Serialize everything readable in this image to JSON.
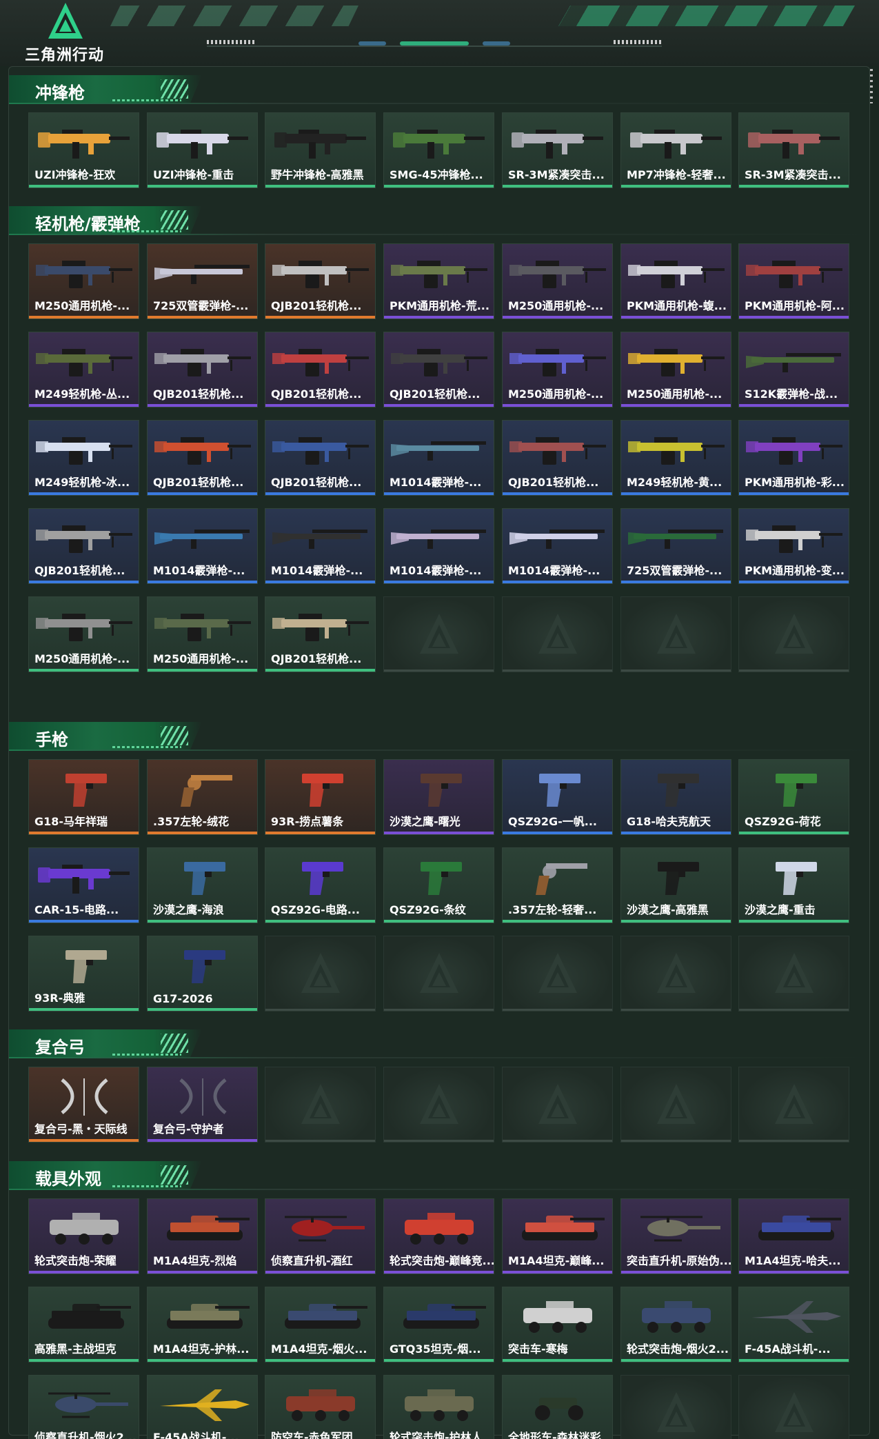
{
  "header": {
    "logo_text": "三角洲行动"
  },
  "sections": [
    {
      "title": "冲锋枪",
      "items": [
        {
          "name": "UZI冲锋枪-狂欢",
          "rarity": "green",
          "art": "smg",
          "color": "#e8a23a"
        },
        {
          "name": "UZI冲锋枪-重击",
          "rarity": "green",
          "art": "smg",
          "color": "#d8d8e8"
        },
        {
          "name": "野牛冲锋枪-高雅黑",
          "rarity": "green",
          "art": "smg",
          "color": "#222222"
        },
        {
          "name": "SMG-45冲锋枪...",
          "rarity": "green",
          "art": "smg",
          "color": "#4a7a3a"
        },
        {
          "name": "SR-3M紧凑突击...",
          "rarity": "green",
          "art": "smg",
          "color": "#b0b0b8"
        },
        {
          "name": "MP7冲锋枪-轻奢...",
          "rarity": "green",
          "art": "smg",
          "color": "#c8c8cc"
        },
        {
          "name": "SR-3M紧凑突击...",
          "rarity": "green",
          "art": "smg",
          "color": "#a86060"
        }
      ]
    },
    {
      "title": "轻机枪/霰弹枪",
      "items": [
        {
          "name": "M250通用机枪-...",
          "rarity": "gold",
          "art": "lmg",
          "color": "#3a4a6a"
        },
        {
          "name": "725双管霰弹枪-...",
          "rarity": "gold",
          "art": "shotgun",
          "color": "#c8c8d8"
        },
        {
          "name": "QJB201轻机枪...",
          "rarity": "gold",
          "art": "lmg",
          "color": "#c0c0c0"
        },
        {
          "name": "PKM通用机枪-荒...",
          "rarity": "purple",
          "art": "lmg",
          "color": "#6a7a4a"
        },
        {
          "name": "M250通用机枪-...",
          "rarity": "purple",
          "art": "lmg",
          "color": "#5a5a60"
        },
        {
          "name": "PKM通用机枪-蝮...",
          "rarity": "purple",
          "art": "lmg",
          "color": "#d0d0d8"
        },
        {
          "name": "PKM通用机枪-阿...",
          "rarity": "purple",
          "art": "lmg",
          "color": "#a04040"
        },
        {
          "name": "M249轻机枪-丛...",
          "rarity": "purple",
          "art": "lmg",
          "color": "#5a6a3a"
        },
        {
          "name": "QJB201轻机枪...",
          "rarity": "purple",
          "art": "lmg",
          "color": "#a0a0a8"
        },
        {
          "name": "QJB201轻机枪...",
          "rarity": "purple",
          "art": "lmg",
          "color": "#c04040"
        },
        {
          "name": "QJB201轻机枪...",
          "rarity": "purple",
          "art": "lmg",
          "color": "#404040"
        },
        {
          "name": "M250通用机枪-...",
          "rarity": "purple",
          "art": "lmg",
          "color": "#6060d0"
        },
        {
          "name": "M250通用机枪-...",
          "rarity": "purple",
          "art": "lmg",
          "color": "#e0b030"
        },
        {
          "name": "S12K霰弹枪-战...",
          "rarity": "purple",
          "art": "shotgun",
          "color": "#4a6a3a"
        },
        {
          "name": "M249轻机枪-冰...",
          "rarity": "blue",
          "art": "lmg",
          "color": "#d8e0f0"
        },
        {
          "name": "QJB201轻机枪...",
          "rarity": "blue",
          "art": "lmg",
          "color": "#d05030"
        },
        {
          "name": "QJB201轻机枪...",
          "rarity": "blue",
          "art": "lmg",
          "color": "#3a5aa0"
        },
        {
          "name": "M1014霰弹枪-...",
          "rarity": "blue",
          "art": "shotgun",
          "color": "#5a8aa0"
        },
        {
          "name": "QJB201轻机枪...",
          "rarity": "blue",
          "art": "lmg",
          "color": "#a05050"
        },
        {
          "name": "M249轻机枪-黄...",
          "rarity": "blue",
          "art": "lmg",
          "color": "#c8c030"
        },
        {
          "name": "PKM通用机枪-彩...",
          "rarity": "blue",
          "art": "lmg",
          "color": "#8040c0"
        },
        {
          "name": "QJB201轻机枪...",
          "rarity": "blue",
          "art": "lmg",
          "color": "#a0a0a0"
        },
        {
          "name": "M1014霰弹枪-...",
          "rarity": "blue",
          "art": "shotgun",
          "color": "#3a7ab0"
        },
        {
          "name": "M1014霰弹枪-...",
          "rarity": "blue",
          "art": "shotgun",
          "color": "#303030"
        },
        {
          "name": "M1014霰弹枪-...",
          "rarity": "blue",
          "art": "shotgun",
          "color": "#c0b0d0"
        },
        {
          "name": "M1014霰弹枪-...",
          "rarity": "blue",
          "art": "shotgun",
          "color": "#d0d0e8"
        },
        {
          "name": "725双管霰弹枪-...",
          "rarity": "blue",
          "art": "shotgun",
          "color": "#2a6a3a"
        },
        {
          "name": "PKM通用机枪-变...",
          "rarity": "blue",
          "art": "lmg",
          "color": "#d0d0d0"
        },
        {
          "name": "M250通用机枪-...",
          "rarity": "green",
          "art": "lmg",
          "color": "#909090"
        },
        {
          "name": "M250通用机枪-...",
          "rarity": "green",
          "art": "lmg",
          "color": "#5a6a4a"
        },
        {
          "name": "QJB201轻机枪...",
          "rarity": "green",
          "art": "lmg",
          "color": "#c0b090"
        },
        {
          "empty": true
        },
        {
          "empty": true
        },
        {
          "empty": true
        },
        {
          "empty": true
        }
      ]
    },
    {
      "title": "手枪",
      "items": [
        {
          "name": "G18-马年祥瑞",
          "rarity": "gold",
          "art": "pistol",
          "color": "#c04030"
        },
        {
          "name": ".357左轮-绒花",
          "rarity": "gold",
          "art": "revolver",
          "color": "#c08040"
        },
        {
          "name": "93R-捞点薯条",
          "rarity": "gold",
          "art": "pistol",
          "color": "#d04030"
        },
        {
          "name": "沙漠之鹰-曙光",
          "rarity": "purple",
          "art": "pistol",
          "color": "#5a3a30"
        },
        {
          "name": "QSZ92G-一帆...",
          "rarity": "blue",
          "art": "pistol",
          "color": "#6a8ad0"
        },
        {
          "name": "G18-哈夫克航天",
          "rarity": "blue",
          "art": "pistol",
          "color": "#303030"
        },
        {
          "name": "QSZ92G-荷花",
          "rarity": "green",
          "art": "pistol",
          "color": "#3a8a3a"
        },
        {
          "name": "CAR-15-电路...",
          "rarity": "blue",
          "art": "smg",
          "color": "#6a3ad0"
        },
        {
          "name": "沙漠之鹰-海浪",
          "rarity": "green",
          "art": "pistol",
          "color": "#3a6aa0"
        },
        {
          "name": "QSZ92G-电路...",
          "rarity": "green",
          "art": "pistol",
          "color": "#5a3ad0"
        },
        {
          "name": "QSZ92G-条纹",
          "rarity": "green",
          "art": "pistol",
          "color": "#2a7a3a"
        },
        {
          "name": ".357左轮-轻奢...",
          "rarity": "green",
          "art": "revolver",
          "color": "#a0a0a8"
        },
        {
          "name": "沙漠之鹰-高雅黑",
          "rarity": "green",
          "art": "pistol",
          "color": "#1a1a1a"
        },
        {
          "name": "沙漠之鹰-重击",
          "rarity": "green",
          "art": "pistol",
          "color": "#d0d8e8"
        },
        {
          "name": "93R-典雅",
          "rarity": "green",
          "art": "pistol",
          "color": "#b0a890"
        },
        {
          "name": "G17-2026",
          "rarity": "green",
          "art": "pistol",
          "color": "#2a3a80"
        },
        {
          "empty": true
        },
        {
          "empty": true
        },
        {
          "empty": true
        },
        {
          "empty": true
        },
        {
          "empty": true
        }
      ]
    },
    {
      "title": "复合弓",
      "items": [
        {
          "name": "复合弓-黑・天际线",
          "rarity": "gold",
          "art": "bow",
          "color": "#d0d0d0"
        },
        {
          "name": "复合弓-守护者",
          "rarity": "purple",
          "art": "bow",
          "color": "#606070"
        },
        {
          "empty": true
        },
        {
          "empty": true
        },
        {
          "empty": true
        },
        {
          "empty": true
        },
        {
          "empty": true
        }
      ]
    },
    {
      "title": "载具外观",
      "items": [
        {
          "name": "轮式突击炮-荣耀",
          "rarity": "purple",
          "art": "vehicle",
          "color": "#b0b0b0"
        },
        {
          "name": "M1A4坦克-烈焰",
          "rarity": "purple",
          "art": "tank",
          "color": "#c05030"
        },
        {
          "name": "侦察直升机-酒红",
          "rarity": "purple",
          "art": "heli",
          "color": "#a02020"
        },
        {
          "name": "轮式突击炮-巅峰竞...",
          "rarity": "purple",
          "art": "vehicle",
          "color": "#d04030"
        },
        {
          "name": "M1A4坦克-巅峰...",
          "rarity": "purple",
          "art": "tank",
          "color": "#d05040"
        },
        {
          "name": "突击直升机-原始伪...",
          "rarity": "purple",
          "art": "heli",
          "color": "#707060"
        },
        {
          "name": "M1A4坦克-哈夫...",
          "rarity": "purple",
          "art": "tank",
          "color": "#3a4aa0"
        },
        {
          "name": "高雅黑-主战坦克",
          "rarity": "green",
          "art": "tank",
          "color": "#1a1a1a"
        },
        {
          "name": "M1A4坦克-护林...",
          "rarity": "green",
          "art": "tank",
          "color": "#7a7a5a"
        },
        {
          "name": "M1A4坦克-烟火...",
          "rarity": "green",
          "art": "tank",
          "color": "#3a4a70"
        },
        {
          "name": "GTQ35坦克-烟...",
          "rarity": "green",
          "art": "tank",
          "color": "#2a3a6a"
        },
        {
          "name": "突击车-寒梅",
          "rarity": "green",
          "art": "vehicle",
          "color": "#d0d0d0"
        },
        {
          "name": "轮式突击炮-烟火2...",
          "rarity": "green",
          "art": "vehicle",
          "color": "#3a4a70"
        },
        {
          "name": "F-45A战斗机-...",
          "rarity": "green",
          "art": "jet",
          "color": "#505560"
        },
        {
          "name": "侦察直升机-烟火2...",
          "rarity": "green",
          "art": "heli",
          "color": "#3a4a6a"
        },
        {
          "name": "F-45A战斗机-...",
          "rarity": "green",
          "art": "jet",
          "color": "#e0b020"
        },
        {
          "name": "防空车-赤色军团",
          "rarity": "green",
          "art": "vehicle",
          "color": "#8a3a2a"
        },
        {
          "name": "轮式突击炮-护林人",
          "rarity": "green",
          "art": "vehicle",
          "color": "#6a6a50"
        },
        {
          "name": "全地形车-森林迷彩",
          "rarity": "green",
          "art": "atv",
          "color": "#2a3a2a"
        },
        {
          "empty": true
        },
        {
          "empty": true
        }
      ]
    }
  ]
}
